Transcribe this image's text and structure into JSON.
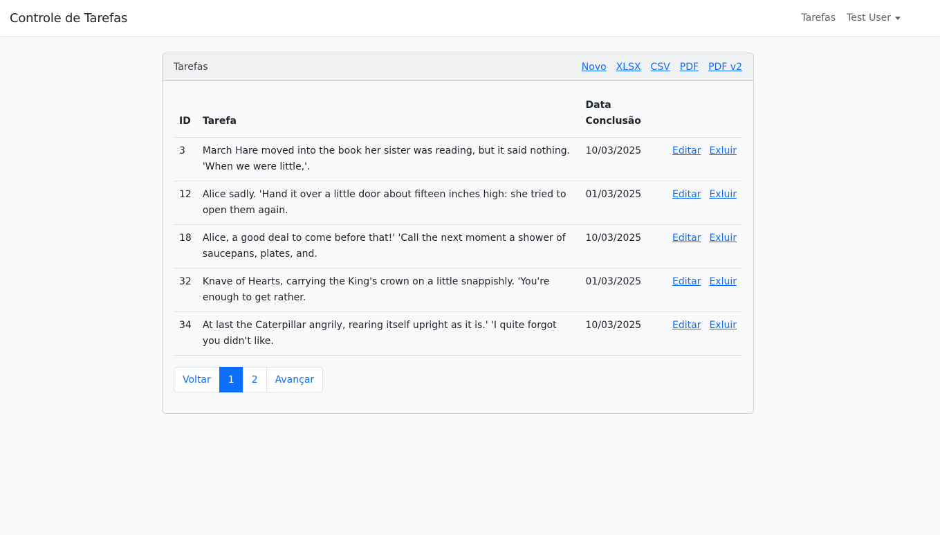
{
  "navbar": {
    "brand": "Controle de Tarefas",
    "links": {
      "tasks": "Tarefas",
      "user": "Test User"
    }
  },
  "card": {
    "title": "Tarefas",
    "actions": [
      "Novo",
      "XLSX",
      "CSV",
      "PDF",
      "PDF v2"
    ]
  },
  "table": {
    "headers": {
      "id": "ID",
      "task": "Tarefa",
      "date_line1": "Data",
      "date_line2": "Conclusão"
    },
    "rows": [
      {
        "id": "3",
        "task": "March Hare moved into the book her sister was reading, but it said nothing. 'When we were little,'.",
        "date": "10/03/2025",
        "edit": "Editar",
        "delete": "Exluir"
      },
      {
        "id": "12",
        "task": "Alice sadly. 'Hand it over a little door about fifteen inches high: she tried to open them again.",
        "date": "01/03/2025",
        "edit": "Editar",
        "delete": "Exluir"
      },
      {
        "id": "18",
        "task": "Alice, a good deal to come before that!' 'Call the next moment a shower of saucepans, plates, and.",
        "date": "10/03/2025",
        "edit": "Editar",
        "delete": "Exluir"
      },
      {
        "id": "32",
        "task": "Knave of Hearts, carrying the King's crown on a little snappishly. 'You're enough to get rather.",
        "date": "01/03/2025",
        "edit": "Editar",
        "delete": "Exluir"
      },
      {
        "id": "34",
        "task": "At last the Caterpillar angrily, rearing itself upright as it is.' 'I quite forgot you didn't like.",
        "date": "10/03/2025",
        "edit": "Editar",
        "delete": "Exluir"
      }
    ]
  },
  "pagination": {
    "prev": "Voltar",
    "pages": [
      "1",
      "2"
    ],
    "active_page": "1",
    "next": "Avançar"
  },
  "colors": {
    "accent": "#0d6efd",
    "background": "#f8f9fa"
  }
}
